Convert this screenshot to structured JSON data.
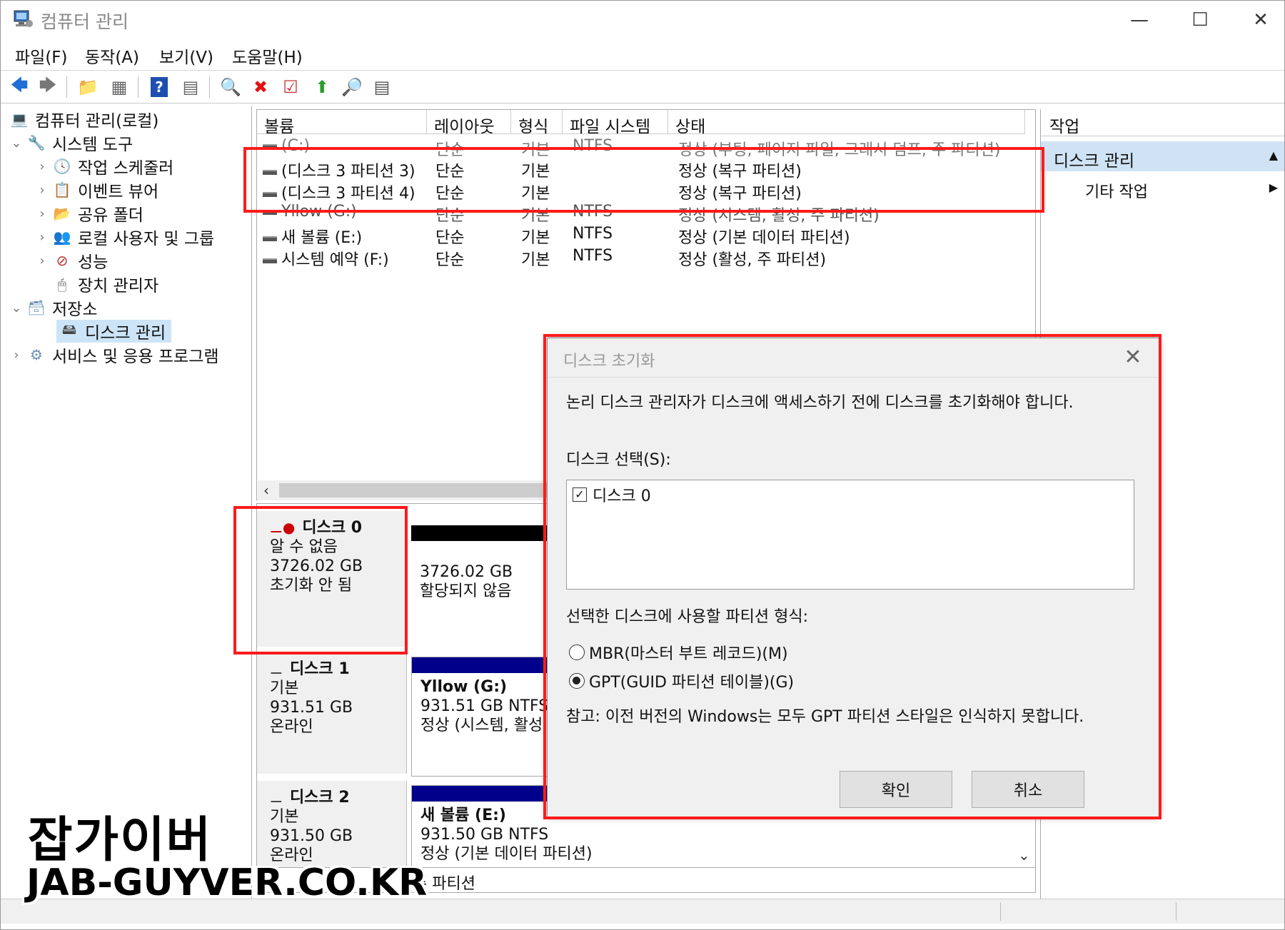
{
  "window": {
    "title": "컴퓨터 관리"
  },
  "menu": [
    "파일(F)",
    "동작(A)",
    "보기(V)",
    "도움말(H)"
  ],
  "toolbar_icons": [
    "back-arrow-icon",
    "forward-arrow-icon",
    "up-folder-icon",
    "console-tree-icon",
    "help-icon",
    "action-pane-icon",
    "connect-icon",
    "delete-icon",
    "properties-icon",
    "export-icon",
    "search-icon",
    "checklist-icon"
  ],
  "tree": {
    "root": "컴퓨터 관리(로컬)",
    "system_tools": "시스템 도구",
    "task_scheduler": "작업 스케줄러",
    "event_viewer": "이벤트 뷰어",
    "shared_folders": "공유 폴더",
    "local_users": "로컬 사용자 및 그룹",
    "performance": "성능",
    "device_manager": "장치 관리자",
    "storage": "저장소",
    "disk_management": "디스크 관리",
    "services": "서비스 및 응용 프로그램"
  },
  "volume_list": {
    "columns": [
      "볼륨",
      "레이아웃",
      "형식",
      "파일 시스템",
      "상태"
    ],
    "rows": [
      {
        "volume": "(C:)",
        "layout": "단순",
        "type": "기본",
        "fs": "NTFS",
        "status": "정상 (부팅, 페이지 파일, 크래시 덤프, 주 파티션)"
      },
      {
        "volume": "(디스크 3 파티션 3)",
        "layout": "단순",
        "type": "기본",
        "fs": "",
        "status": "정상 (복구 파티션)"
      },
      {
        "volume": "(디스크 3 파티션 4)",
        "layout": "단순",
        "type": "기본",
        "fs": "",
        "status": "정상 (복구 파티션)"
      },
      {
        "volume": "Yllow (G:)",
        "layout": "단순",
        "type": "기본",
        "fs": "NTFS",
        "status": "정상 (시스템, 활성, 주 파티션)"
      },
      {
        "volume": "새 볼륨 (E:)",
        "layout": "단순",
        "type": "기본",
        "fs": "NTFS",
        "status": "정상 (기본 데이터 파티션)"
      },
      {
        "volume": "시스템 예약 (F:)",
        "layout": "단순",
        "type": "기본",
        "fs": "NTFS",
        "status": "정상 (활성, 주 파티션)"
      }
    ]
  },
  "disks": [
    {
      "name": "디스크 0",
      "kind": "알 수 없음",
      "size": "3726.02 GB",
      "state": "초기화 안 됨",
      "part_size": "3726.02 GB",
      "part_status": "할당되지 않음"
    },
    {
      "name": "디스크 1",
      "kind": "기본",
      "size": "931.51 GB",
      "state": "온라인",
      "part_name": "Yllow  (G:)",
      "part_size": "931.51 GB NTFS",
      "part_status": "정상 (시스템, 활성"
    },
    {
      "name": "디스크 2",
      "kind": "기본",
      "size": "931.50 GB",
      "state": "온라인",
      "part_name": "새 볼륨  (E:)",
      "part_size": "931.50 GB NTFS",
      "part_status": "정상 (기본 데이터 파티션)"
    }
  ],
  "legend_fragment": "주 파티션",
  "actions": {
    "header": "작업",
    "selected": "디스크 관리",
    "other": "기타 작업"
  },
  "dialog": {
    "title": "디스크 초기화",
    "message": "논리 디스크 관리자가 디스크에 액세스하기 전에 디스크를 초기화해야 합니다.",
    "select_label": "디스크 선택(S):",
    "disk_item": "디스크 0",
    "disk_checked": true,
    "format_label": "선택한 디스크에 사용할 파티션 형식:",
    "mbr": "MBR(마스터 부트 레코드)(M)",
    "gpt": "GPT(GUID 파티션 테이블)(G)",
    "selected_format": "GPT",
    "note": "참고: 이전 버전의 Windows는 모두 GPT 파티션 스타일은 인식하지 못합니다.",
    "ok": "확인",
    "cancel": "취소"
  },
  "watermark": {
    "line1": "잡가이버",
    "line2": "JAB-GUYVER.CO.KR"
  },
  "colors": {
    "highlight": "#ff1a1a",
    "primary_bar": "#00008b",
    "unallocated_bar": "#000000",
    "selection": "#cce4f7"
  }
}
